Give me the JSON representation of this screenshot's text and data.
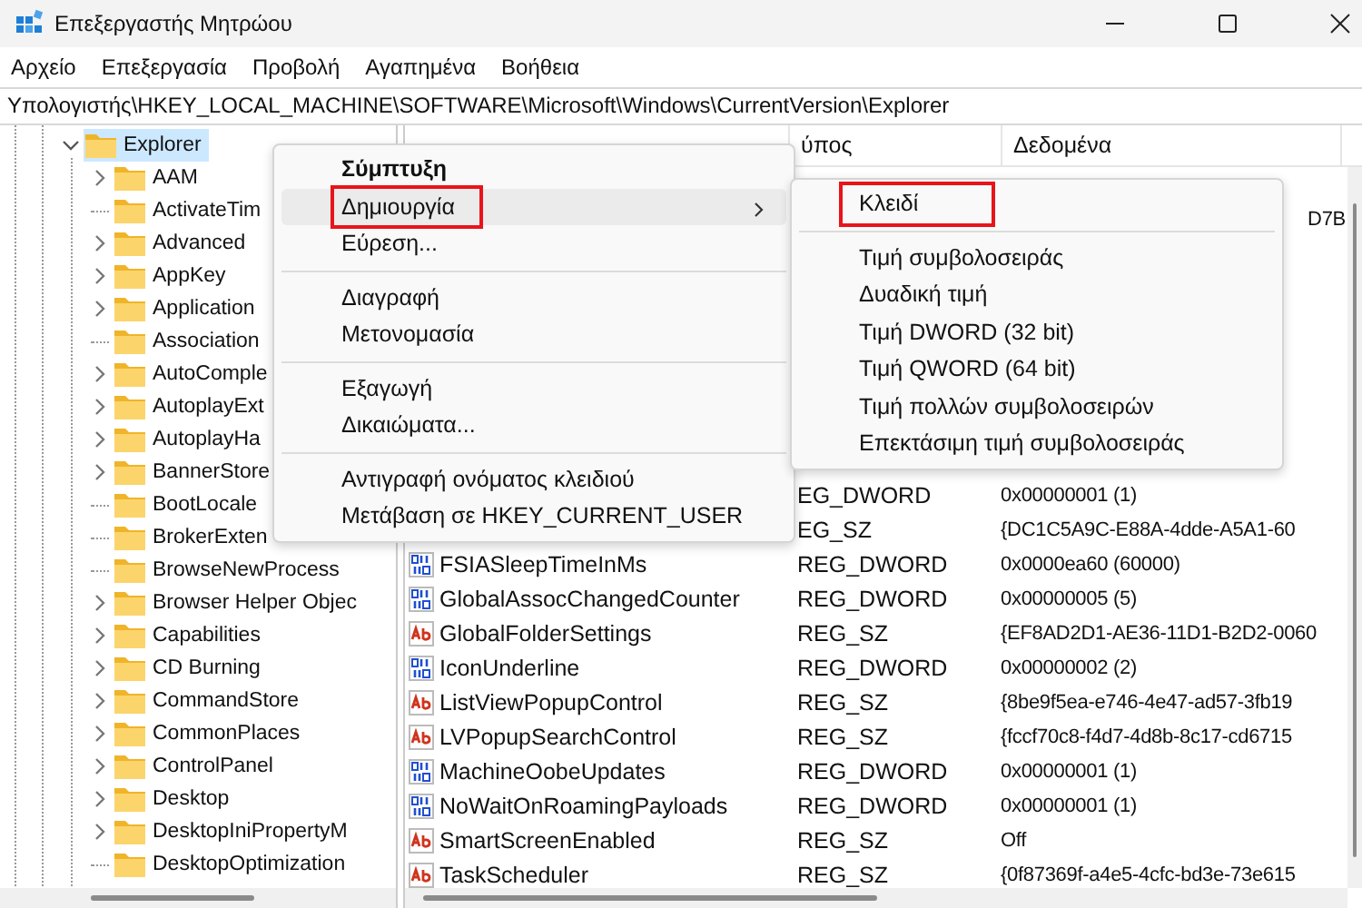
{
  "window": {
    "title": "Επεξεργαστής Μητρώου"
  },
  "menu_bar": [
    "Αρχείο",
    "Επεξεργασία",
    "Προβολή",
    "Αγαπημένα",
    "Βοήθεια"
  ],
  "address": "Υπολογιστής\\HKEY_LOCAL_MACHINE\\SOFTWARE\\Microsoft\\Windows\\CurrentVersion\\Explorer",
  "tree": {
    "label": "Explorer",
    "expanded": true,
    "selected": true,
    "children": [
      {
        "label": "AAM",
        "expandable": true,
        "selected": false
      },
      {
        "label": "ActivateTim",
        "expandable": false,
        "selected": false
      },
      {
        "label": "Advanced",
        "expandable": true,
        "selected": false
      },
      {
        "label": "AppKey",
        "expandable": true,
        "selected": false
      },
      {
        "label": "Application",
        "expandable": true,
        "selected": false
      },
      {
        "label": "Association",
        "expandable": false,
        "selected": false
      },
      {
        "label": "AutoComple",
        "expandable": true,
        "selected": false
      },
      {
        "label": "AutoplayExt",
        "expandable": true,
        "selected": false
      },
      {
        "label": "AutoplayHa",
        "expandable": true,
        "selected": false
      },
      {
        "label": "BannerStore",
        "expandable": true,
        "selected": false
      },
      {
        "label": "BootLocale",
        "expandable": false,
        "selected": false
      },
      {
        "label": "BrokerExten",
        "expandable": false,
        "selected": false
      },
      {
        "label": "BrowseNewProcess",
        "expandable": false,
        "selected": false
      },
      {
        "label": "Browser Helper Objec",
        "expandable": true,
        "selected": false
      },
      {
        "label": "Capabilities",
        "expandable": true,
        "selected": false
      },
      {
        "label": "CD Burning",
        "expandable": true,
        "selected": false
      },
      {
        "label": "CommandStore",
        "expandable": true,
        "selected": false
      },
      {
        "label": "CommonPlaces",
        "expandable": true,
        "selected": false
      },
      {
        "label": "ControlPanel",
        "expandable": true,
        "selected": false
      },
      {
        "label": "Desktop",
        "expandable": true,
        "selected": false
      },
      {
        "label": "DesktopIniPropertyM",
        "expandable": true,
        "selected": false
      },
      {
        "label": "DesktopOptimization",
        "expandable": false,
        "selected": false
      }
    ]
  },
  "table": {
    "columns": [
      "ύπος",
      "Δεδομένα"
    ],
    "rows": [
      {
        "data": "D7B"
      },
      {
        "type": "EG_DWORD",
        "data": "0x00000001 (1)"
      },
      {
        "type": "EG_SZ",
        "data": "{DC1C5A9C-E88A-4dde-A5A1-60"
      },
      {
        "kind": "binary",
        "name": "FSIASleepTimeInMs",
        "type": "REG_DWORD",
        "data": "0x0000ea60 (60000)"
      },
      {
        "kind": "binary",
        "name": "GlobalAssocChangedCounter",
        "type": "REG_DWORD",
        "data": "0x00000005 (5)"
      },
      {
        "kind": "string",
        "name": "GlobalFolderSettings",
        "type": "REG_SZ",
        "data": "{EF8AD2D1-AE36-11D1-B2D2-0060"
      },
      {
        "kind": "binary",
        "name": "IconUnderline",
        "type": "REG_DWORD",
        "data": "0x00000002 (2)"
      },
      {
        "kind": "string",
        "name": "ListViewPopupControl",
        "type": "REG_SZ",
        "data": "{8be9f5ea-e746-4e47-ad57-3fb19"
      },
      {
        "kind": "string",
        "name": "LVPopupSearchControl",
        "type": "REG_SZ",
        "data": "{fccf70c8-f4d7-4d8b-8c17-cd6715"
      },
      {
        "kind": "binary",
        "name": "MachineOobeUpdates",
        "type": "REG_DWORD",
        "data": "0x00000001 (1)"
      },
      {
        "kind": "binary",
        "name": "NoWaitOnRoamingPayloads",
        "type": "REG_DWORD",
        "data": "0x00000001 (1)"
      },
      {
        "kind": "string",
        "name": "SmartScreenEnabled",
        "type": "REG_SZ",
        "data": "Off"
      },
      {
        "kind": "string",
        "name": "TaskScheduler",
        "type": "REG_SZ",
        "data": "{0f87369f-a4e5-4cfc-bd3e-73e615"
      }
    ]
  },
  "context_menu": [
    {
      "kind": "item",
      "label": "Σύμπτυξη",
      "bold": true,
      "selected": false
    },
    {
      "kind": "item",
      "label": "Δημιουργία",
      "selected": true,
      "submenu": true,
      "outlined": true
    },
    {
      "kind": "item",
      "label": "Εύρεση...",
      "selected": false
    },
    {
      "kind": "separator"
    },
    {
      "kind": "item",
      "label": "Διαγραφή",
      "selected": false
    },
    {
      "kind": "item",
      "label": "Μετονομασία",
      "selected": false
    },
    {
      "kind": "separator"
    },
    {
      "kind": "item",
      "label": "Εξαγωγή",
      "selected": false
    },
    {
      "kind": "item",
      "label": "Δικαιώματα...",
      "selected": false
    },
    {
      "kind": "separator"
    },
    {
      "kind": "item",
      "label": "Αντιγραφή ονόματος κλειδιού",
      "selected": false
    },
    {
      "kind": "item",
      "label": "Μετάβαση σε HKEY_CURRENT_USER",
      "selected": false
    }
  ],
  "submenu": [
    {
      "kind": "item",
      "label": "Κλειδί",
      "selected": false,
      "outlined": true
    },
    {
      "kind": "separator"
    },
    {
      "kind": "item",
      "label": "Τιμή συμβολοσειράς",
      "selected": false
    },
    {
      "kind": "item",
      "label": "Δυαδική τιμή",
      "selected": false
    },
    {
      "kind": "item",
      "label": "Τιμή DWORD (32 bit)",
      "selected": false
    },
    {
      "kind": "item",
      "label": "Τιμή QWORD (64 bit)",
      "selected": false
    },
    {
      "kind": "item",
      "label": "Τιμή πολλών συμβολοσειρών",
      "selected": false
    },
    {
      "kind": "item",
      "label": "Επεκτάσιμη τιμή συμβολοσειράς",
      "selected": false
    }
  ]
}
